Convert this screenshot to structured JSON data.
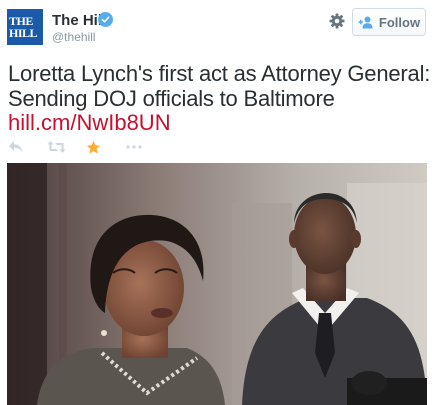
{
  "account": {
    "avatar_lines": [
      "THE",
      "HILL"
    ],
    "name": "The Hill",
    "handle": "@thehill",
    "verified": true
  },
  "header": {
    "follow_label": "Follow",
    "icons": [
      "gear-icon",
      "add-user-icon",
      "verified-badge-icon"
    ]
  },
  "tweet": {
    "text": "Loretta Lynch's first act as Attorney General: Sending DOJ officials to Baltimore",
    "link": "hill.cm/NwIb8UN"
  },
  "actions": {
    "icons": [
      "reply-icon",
      "retweet-icon",
      "favorite-icon",
      "more-icon"
    ]
  },
  "colors": {
    "link": "#c8102e",
    "favorite": "#ffac33",
    "verified": "#55acee",
    "avatar_bg": "#1a5aa8",
    "muted": "#8899a6",
    "text": "#292f33"
  }
}
